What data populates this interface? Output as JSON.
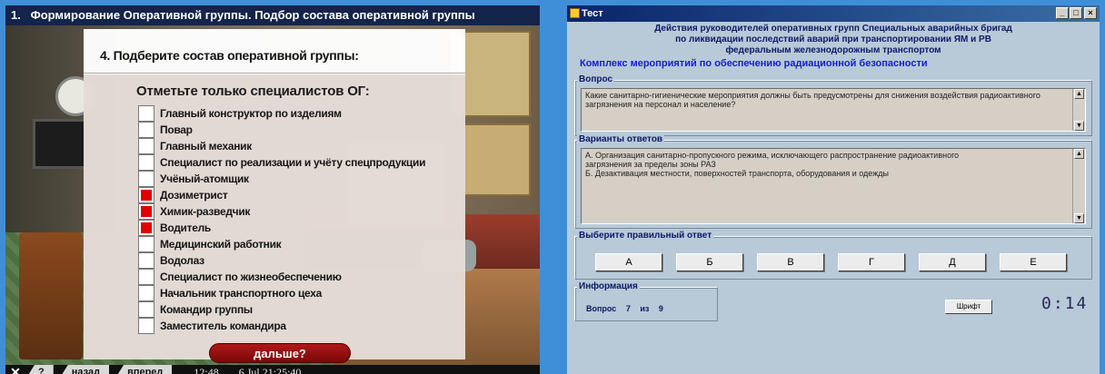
{
  "left": {
    "title_number": "1.",
    "title": "Формирование Оперативной группы. Подбор состава оперативной группы",
    "question": "4. Подберите состав оперативной группы:",
    "instruction": "Отметьте только специалистов ОГ:",
    "options": [
      {
        "label": "Главный конструктор по изделиям",
        "checked": false
      },
      {
        "label": "Повар",
        "checked": false
      },
      {
        "label": "Главный механик",
        "checked": false
      },
      {
        "label": "Специалист  по реализации и учёту спецпродукции",
        "checked": false
      },
      {
        "label": "Учёный-атомщик",
        "checked": false
      },
      {
        "label": "Дозиметрист",
        "checked": true
      },
      {
        "label": "Химик-разведчик",
        "checked": true
      },
      {
        "label": "Водитель",
        "checked": true
      },
      {
        "label": "Медицинский работник",
        "checked": false
      },
      {
        "label": "Водолаз",
        "checked": false
      },
      {
        "label": "Специалист по жизнеобеспечению",
        "checked": false
      },
      {
        "label": "Начальник транспортного цеха",
        "checked": false
      },
      {
        "label": "Командир группы",
        "checked": false
      },
      {
        "label": "Заместитель командира",
        "checked": false
      }
    ],
    "next_label": "дальше?",
    "bottom": {
      "close": "✕",
      "help": "?",
      "back": "назад",
      "forward": "вперед",
      "time": "12:48",
      "datetime": "6 Jul 21:25:40"
    }
  },
  "right": {
    "window_title": "Тест",
    "header_lines": [
      "Действия руководителей оперативных групп Специальных аварийных бригад",
      "по ликвидации последствий аварий при транспортировании ЯМ и РВ",
      "федеральным железнодорожным транспортом"
    ],
    "section": "Комплекс мероприятий по обеспечению радиационной безопасности",
    "question_title": "Вопрос",
    "question_text": "Какие санитарно-гигиенические мероприятия должны быть предусмотрены для снижения воздействия радиоактивного загрязнения на персонал и население?",
    "answers_title": "Варианты ответов",
    "answers_lines": [
      "А.    Организация санитарно-пропускного режима, исключающего распространение радиоактивного",
      "загрязнения за пределы зоны РАЗ",
      "Б.    Дезактивация местности, поверхностей транспорта, оборудования и одежды"
    ],
    "choose_title": "Выберите правильный ответ",
    "answer_buttons": [
      "А",
      "Б",
      "В",
      "Г",
      "Д",
      "Е"
    ],
    "info_title": "Информация",
    "info_question": "Вопрос",
    "info_current": "7",
    "info_of": "из",
    "info_total": "9",
    "font_button": "Шрифт",
    "timer": "0:14"
  }
}
